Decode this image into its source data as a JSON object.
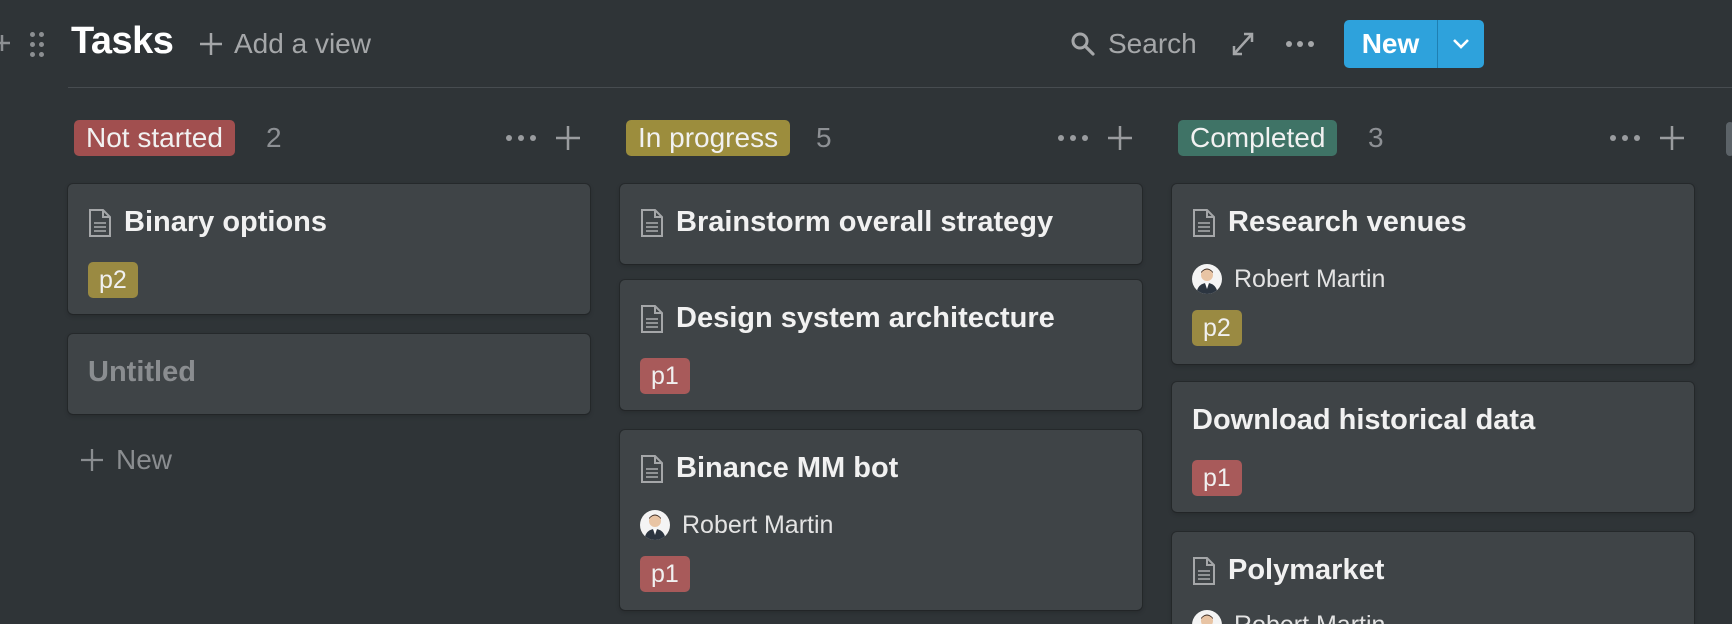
{
  "header": {
    "title": "Tasks",
    "add_view_label": "Add a view",
    "search_label": "Search",
    "new_label": "New"
  },
  "columns": [
    {
      "label": "Not started",
      "count": "2",
      "color": "#a14f4f",
      "cards": [
        {
          "title": "Binary options",
          "tag": "p2"
        },
        {
          "title": "Untitled"
        }
      ],
      "add_label": "New"
    },
    {
      "label": "In progress",
      "count": "5",
      "color": "#9c8d3d",
      "cards": [
        {
          "title": "Brainstorm overall strategy"
        },
        {
          "title": "Design system architecture",
          "tag": "p1"
        },
        {
          "title": "Binance MM bot",
          "assignee": "Robert Martin",
          "tag": "p1"
        }
      ]
    },
    {
      "label": "Completed",
      "count": "3",
      "color": "#3f7366",
      "cards": [
        {
          "title": "Research venues",
          "assignee": "Robert Martin",
          "tag": "p2"
        },
        {
          "title": "Download historical data",
          "tag": "p1"
        },
        {
          "title": "Polymarket",
          "assignee": "Robert Martin"
        }
      ]
    }
  ],
  "colors": {
    "background": "#2f3437",
    "card": "#3f4447",
    "accent": "#2ea2dc",
    "tag_p1": "#a85a5a",
    "tag_p2": "#9a8a42"
  }
}
